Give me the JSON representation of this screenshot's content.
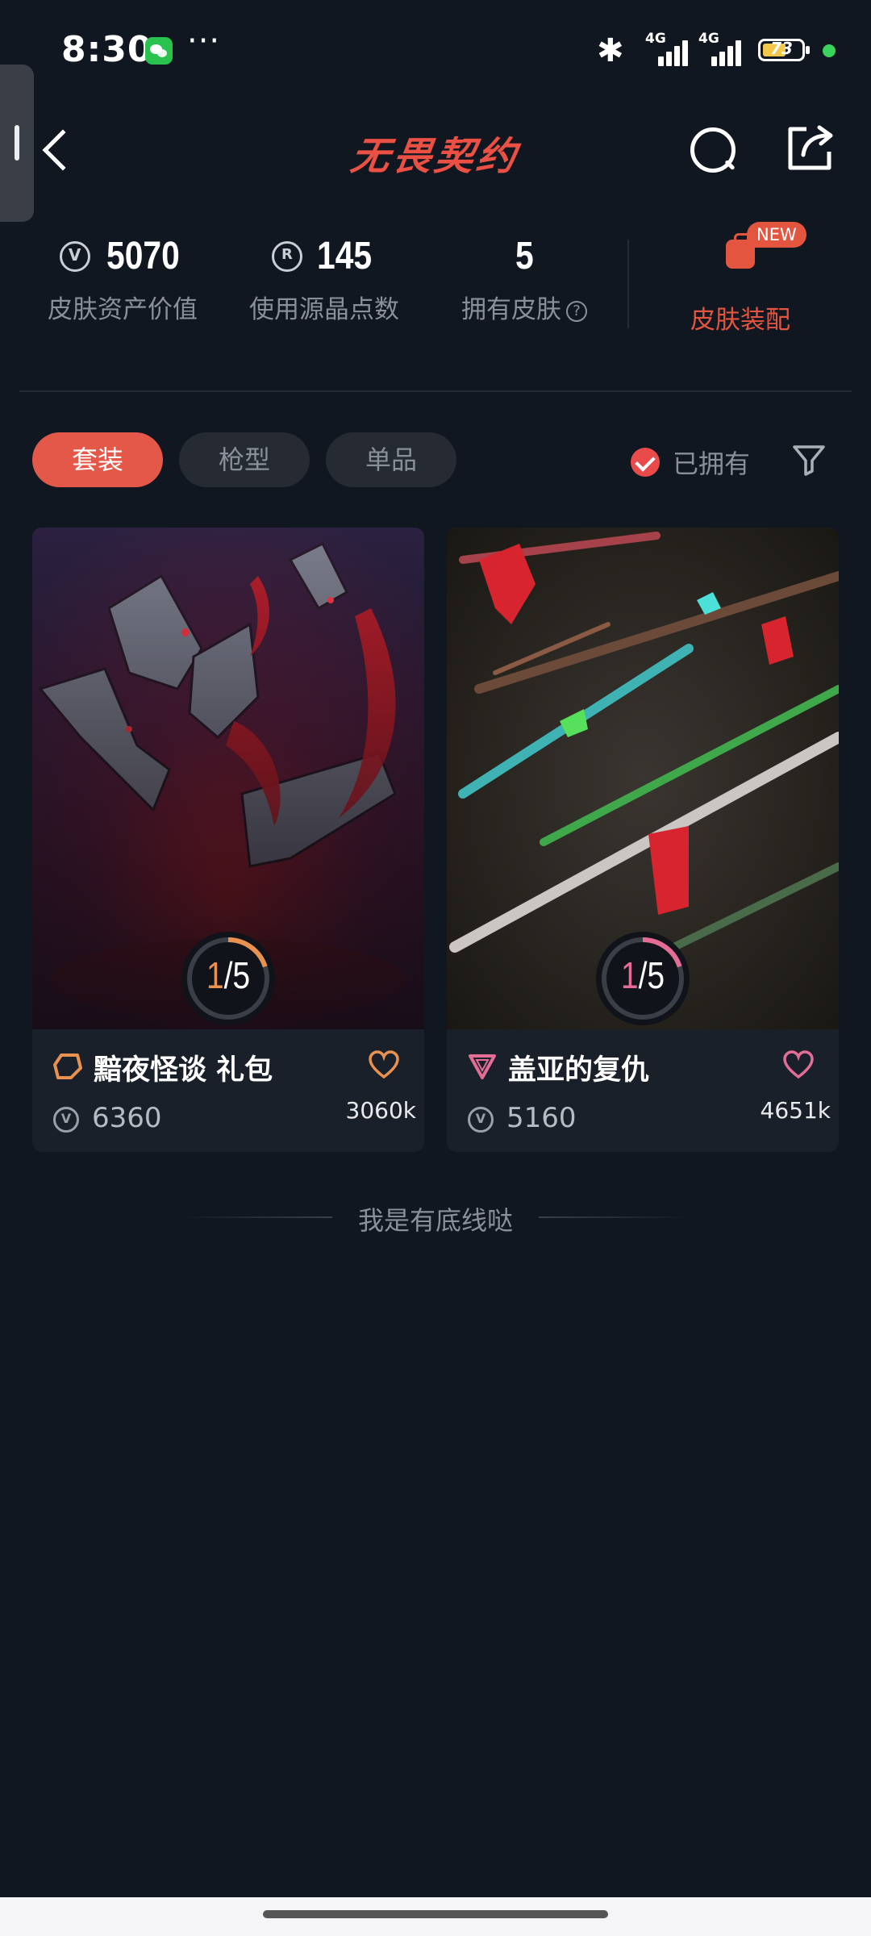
{
  "status_bar": {
    "time": "8:30",
    "more": "···",
    "network_a": "4G",
    "network_b": "4G",
    "battery": "73"
  },
  "header": {
    "title": "无畏契约",
    "icons": [
      "back-icon",
      "search-icon",
      "share-icon"
    ]
  },
  "stats": [
    {
      "value": "5070",
      "label": "皮肤资产价值",
      "icon": "vp-coin-icon"
    },
    {
      "value": "145",
      "label": "使用源晶点数",
      "icon": "radianite-icon"
    },
    {
      "value": "5",
      "label": "拥有皮肤",
      "icon": "help-icon"
    }
  ],
  "loadout": {
    "label": "皮肤装配",
    "badge": "NEW"
  },
  "filters": {
    "tabs": [
      "套装",
      "枪型",
      "单品"
    ],
    "active_tab": "套装",
    "owned_label": "已拥有",
    "owned_checked": true
  },
  "cards": [
    {
      "name": "黯夜怪谈 礼包",
      "owned": "1",
      "total": "/5",
      "owned_fraction": 0.2,
      "price": "6360",
      "likes": "3060k",
      "accent": "#e9914f",
      "tier_icon": "premium-tier-icon"
    },
    {
      "name": "盖亚的复仇",
      "owned": "1",
      "total": "/5",
      "owned_fraction": 0.2,
      "price": "5160",
      "likes": "4651k",
      "accent": "#e46d96",
      "tier_icon": "exclusive-tier-icon"
    }
  ],
  "footer_text": "我是有底线哒",
  "colors": {
    "background": "#111720",
    "accent_red": "#e4584a",
    "title_red": "#ea5043"
  }
}
